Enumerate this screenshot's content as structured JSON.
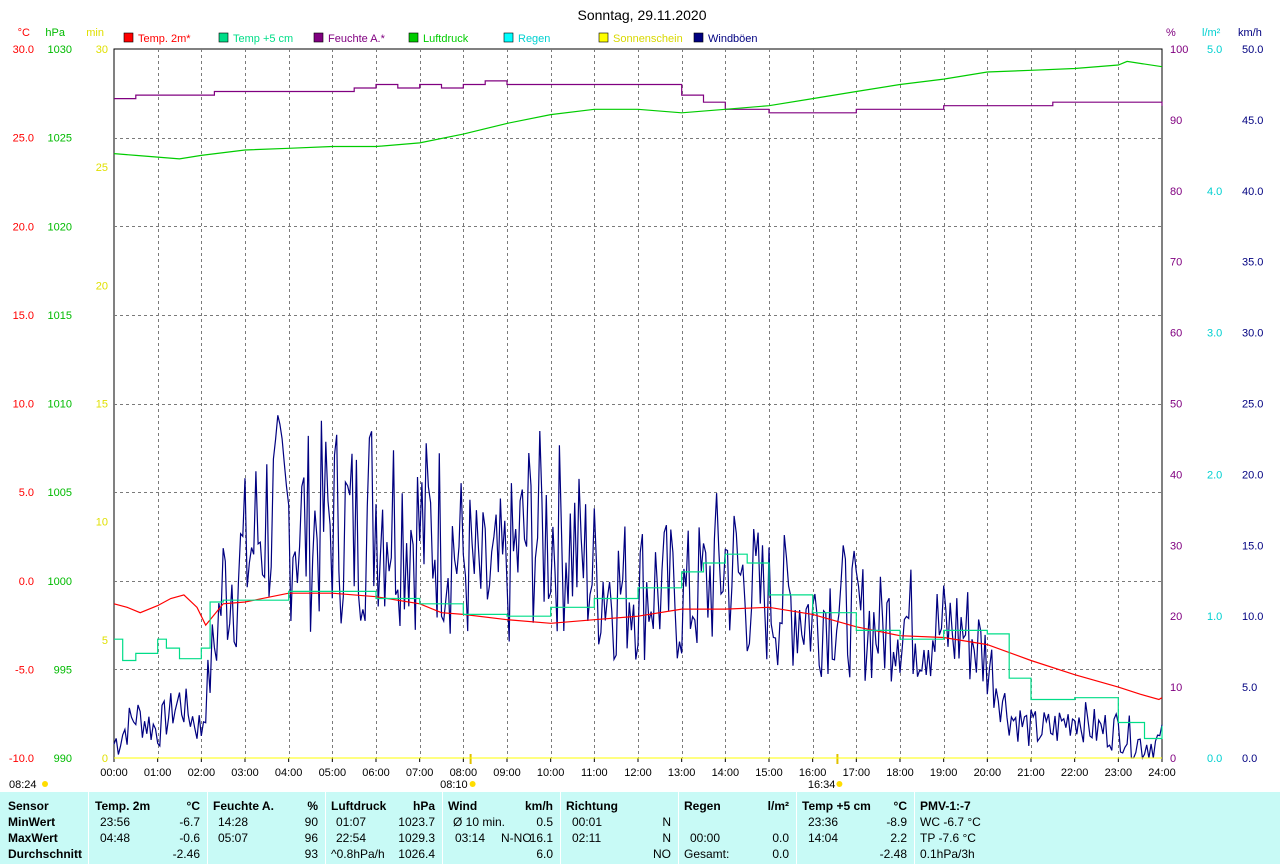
{
  "chart_data": {
    "type": "line",
    "title": "Sonntag, 29.11.2020",
    "x_tick_labels": [
      "00:00",
      "01:00",
      "02:00",
      "03:00",
      "04:00",
      "05:00",
      "06:00",
      "07:00",
      "08:00",
      "09:00",
      "10:00",
      "11:00",
      "12:00",
      "13:00",
      "14:00",
      "15:00",
      "16:00",
      "17:00",
      "18:00",
      "19:00",
      "20:00",
      "21:00",
      "22:00",
      "23:00",
      "24:00"
    ],
    "xlim_hours": [
      0,
      24
    ],
    "axes": {
      "temp": {
        "unit": "°C",
        "color": "#ff0000",
        "range": [
          -10,
          30
        ],
        "ticks": [
          "-10.0",
          "-5.0",
          "0.0",
          "5.0",
          "10.0",
          "15.0",
          "20.0",
          "25.0",
          "30.0"
        ]
      },
      "pressure": {
        "unit": "hPa",
        "color": "#00bb00",
        "range": [
          990,
          1030
        ],
        "ticks": [
          "990",
          "995",
          "1000",
          "1005",
          "1010",
          "1015",
          "1020",
          "1025",
          "1030"
        ]
      },
      "sunshine": {
        "unit": "min",
        "color": "#ffff00",
        "range": [
          0,
          30
        ],
        "ticks": [
          "0",
          "5",
          "10",
          "15",
          "20",
          "25",
          "30"
        ]
      },
      "humidity": {
        "unit": "%",
        "color": "#800080",
        "range": [
          0,
          100
        ],
        "ticks": [
          "0",
          "10",
          "20",
          "30",
          "40",
          "50",
          "60",
          "70",
          "80",
          "90",
          "100"
        ]
      },
      "rain": {
        "unit": "l/m²",
        "color": "#00ffff",
        "range": [
          0,
          5
        ],
        "ticks": [
          "0.0",
          "1.0",
          "2.0",
          "3.0",
          "4.0",
          "5.0"
        ]
      },
      "wind": {
        "unit": "km/h",
        "color": "#000080",
        "range": [
          0,
          50
        ],
        "ticks": [
          "0.0",
          "5.0",
          "10.0",
          "15.0",
          "20.0",
          "25.0",
          "30.0",
          "35.0",
          "40.0",
          "45.0",
          "50.0"
        ]
      }
    },
    "grid": true,
    "legend_position": "top",
    "series": [
      {
        "name": "Temp. 2m*",
        "color": "#ff0000",
        "axis": "temp",
        "x": [
          0,
          0.3,
          0.6,
          1,
          1.3,
          1.6,
          1.9,
          2.1,
          2.5,
          3,
          4,
          5,
          6,
          7,
          7.5,
          8,
          9,
          10,
          11,
          12,
          13,
          14,
          15,
          16,
          17,
          18,
          19,
          20,
          21,
          22,
          23,
          23.5,
          23.93,
          24
        ],
        "y": [
          -1.3,
          -1.5,
          -1.8,
          -1.4,
          -1.0,
          -0.8,
          -1.5,
          -2.5,
          -1.3,
          -1.2,
          -0.7,
          -0.7,
          -0.9,
          -1.3,
          -1.8,
          -1.9,
          -2.2,
          -2.4,
          -2.2,
          -2.0,
          -1.6,
          -1.6,
          -1.5,
          -1.9,
          -2.6,
          -3.1,
          -3.2,
          -3.6,
          -4.5,
          -5.3,
          -6.0,
          -6.4,
          -6.7,
          -6.6
        ]
      },
      {
        "name": "Temp +5 cm",
        "color": "#00dd88",
        "axis": "temp",
        "x": [
          0,
          0.2,
          0.5,
          1,
          1.2,
          1.5,
          2,
          2.2,
          2.5,
          3,
          4,
          5,
          6,
          7,
          8,
          9,
          10,
          11,
          12,
          13,
          13.5,
          14,
          14.5,
          15,
          16,
          17,
          18,
          19,
          20,
          20.5,
          21,
          22,
          23,
          23.6,
          24
        ],
        "y": [
          -3.3,
          -4.5,
          -4.1,
          -3.3,
          -3.8,
          -4.4,
          -3.8,
          -1.2,
          -1.1,
          -1.1,
          -0.6,
          -0.6,
          -1.0,
          -1.3,
          -1.9,
          -2.0,
          -1.5,
          -1.0,
          -0.4,
          0.5,
          1.0,
          1.5,
          1.0,
          -0.8,
          -1.8,
          -2.8,
          -3.3,
          -2.8,
          -3.0,
          -5.5,
          -6.7,
          -6.6,
          -8.0,
          -8.9,
          -8.2
        ]
      },
      {
        "name": "Feuchte A.*",
        "color": "#800080",
        "axis": "humidity",
        "x": [
          0,
          0.5,
          1,
          1.5,
          2,
          2.3,
          3,
          4,
          5,
          5.5,
          6,
          6.5,
          7,
          7.5,
          8,
          8.5,
          9,
          10,
          11,
          12,
          13,
          13.5,
          14,
          15,
          15.5,
          16,
          16.5,
          17,
          18,
          19,
          20,
          21,
          21.5,
          22,
          23,
          24
        ],
        "y": [
          93,
          93.5,
          93.5,
          93.5,
          93.5,
          94,
          94,
          94,
          94,
          94.5,
          95,
          94.5,
          95,
          94.5,
          95,
          95.5,
          95,
          95,
          95,
          95,
          93.5,
          92.5,
          91.5,
          91,
          91,
          91,
          91,
          91.5,
          91.5,
          92,
          92,
          92,
          92.5,
          92.5,
          92.5,
          92
        ]
      },
      {
        "name": "Luftdruck",
        "color": "#00cc00",
        "axis": "pressure",
        "x": [
          0,
          0.5,
          1,
          1.5,
          2,
          3,
          4,
          5,
          6,
          7,
          8,
          9,
          10,
          11,
          12,
          13,
          14,
          15,
          16,
          17,
          18,
          19,
          20,
          21,
          22,
          23,
          23.2,
          24
        ],
        "y": [
          1024.1,
          1024.0,
          1023.9,
          1023.8,
          1024.0,
          1024.3,
          1024.4,
          1024.5,
          1024.5,
          1024.7,
          1025.2,
          1025.8,
          1026.3,
          1026.6,
          1026.6,
          1026.4,
          1026.6,
          1026.8,
          1027.2,
          1027.6,
          1028.0,
          1028.3,
          1028.7,
          1028.8,
          1028.9,
          1029.1,
          1029.3,
          1029.0
        ]
      },
      {
        "name": "Regen",
        "color": "#00ffff",
        "axis": "rain",
        "x": [
          0,
          24
        ],
        "y": [
          0,
          0
        ]
      },
      {
        "name": "Sonnenschein",
        "color": "#ffff00",
        "axis": "sunshine",
        "x": [
          0,
          24
        ],
        "y": [
          0,
          0
        ]
      },
      {
        "name": "Windböen",
        "color": "#000080",
        "axis": "wind",
        "x": [
          0,
          0.5,
          1,
          1.5,
          2,
          2.5,
          3,
          3.5,
          4,
          4.5,
          5,
          5.5,
          6,
          6.5,
          7,
          7.5,
          8,
          8.5,
          9,
          9.5,
          10,
          10.5,
          11,
          11.5,
          12,
          12.5,
          13,
          13.5,
          14,
          14.5,
          15,
          15.5,
          16,
          16.5,
          17,
          17.5,
          18,
          18.5,
          19,
          19.5,
          20,
          20.5,
          21,
          21.5,
          22,
          22.5,
          23,
          23.5,
          24
        ],
        "y": [
          1,
          3,
          2,
          4,
          2,
          12,
          14,
          17,
          17,
          16,
          17,
          16,
          18,
          17,
          16,
          16,
          14,
          12,
          13,
          16,
          16,
          15,
          13,
          12,
          12,
          12,
          11,
          12,
          14,
          12,
          11,
          11,
          10,
          11,
          10,
          9,
          10,
          9,
          9,
          9,
          7,
          3,
          2,
          2,
          3,
          2,
          2,
          1,
          1
        ]
      }
    ],
    "sun_markers": {
      "sunrise": "08:10",
      "sunset": "16:34",
      "sunrise_label": "08:10",
      "sunset_label": "16:34",
      "day_length_label": "08:24"
    }
  },
  "legend": [
    {
      "label": "Temp. 2m*",
      "color": "#ff0000"
    },
    {
      "label": "Temp +5 cm",
      "color": "#00dd88"
    },
    {
      "label": "Feuchte A.*",
      "color": "#800080"
    },
    {
      "label": "Luftdruck",
      "color": "#00cc00"
    },
    {
      "label": "Regen",
      "color": "#00ffff"
    },
    {
      "label": "Sonnenschein",
      "color": "#ffff00"
    },
    {
      "label": "Windböen",
      "color": "#000080"
    }
  ],
  "stats": {
    "row_labels": {
      "sensor": "Sensor",
      "min": "MinWert",
      "max": "MaxWert",
      "avg": "Durchschnitt"
    },
    "temp2m": {
      "head": "Temp. 2m",
      "unit": "°C",
      "min_time": "23:56",
      "min_val": "-6.7",
      "max_time": "04:48",
      "max_val": "-0.6",
      "avg": "-2.46"
    },
    "humidity": {
      "head": "Feuchte A.",
      "unit": "%",
      "min_time": "14:28",
      "min_val": "90",
      "max_time": "05:07",
      "max_val": "96",
      "avg": "93"
    },
    "pressure": {
      "head": "Luftdruck",
      "unit": "hPa",
      "min_time": "01:07",
      "min_val": "1023.7",
      "max_time": "22:54",
      "max_val": "1029.3",
      "trend": "^0.8hPa/h",
      "avg": "1026.4"
    },
    "wind": {
      "head": "Wind",
      "unit": "km/h",
      "min_label": "Ø 10 min.",
      "min_val": "0.5",
      "max_time": "03:14",
      "max_dir": "N-NO",
      "max_val": "16.1",
      "avg": "6.0"
    },
    "direction": {
      "head": "Richtung",
      "min_time": "00:01",
      "min_dir": "N",
      "max_time": "02:11",
      "max_dir": "N",
      "avg_dir": "NO"
    },
    "rain": {
      "head": "Regen",
      "unit": "l/m²",
      "max_time": "00:00",
      "max_val": "0.0",
      "total_label": "Gesamt:",
      "total_val": "0.0"
    },
    "temp5cm": {
      "head": "Temp +5 cm",
      "unit": "°C",
      "min_time": "23:36",
      "min_val": "-8.9",
      "max_time": "14:04",
      "max_val": "2.2",
      "avg": "-2.48"
    },
    "pmv": {
      "head": "PMV-1:-7",
      "wc": "WC -6.7 °C",
      "tp": "TP -7.6 °C",
      "trend": "0.1hPa/3h"
    }
  }
}
